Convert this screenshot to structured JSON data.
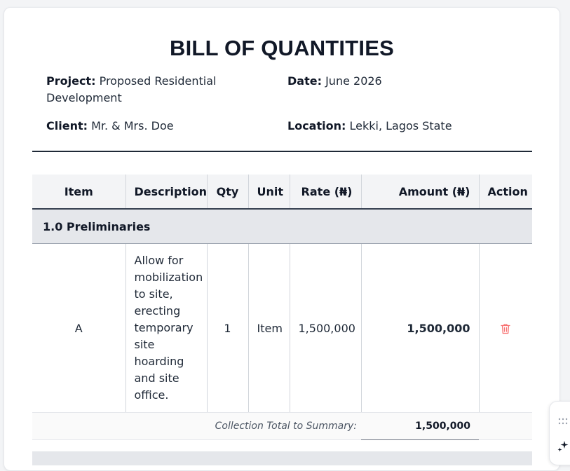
{
  "document": {
    "title": "BILL OF QUANTITIES"
  },
  "meta": {
    "project_label": "Project:",
    "project_value": "Proposed Residential Development",
    "date_label": "Date:",
    "date_value": "June 2026",
    "client_label": "Client:",
    "client_value": "Mr. & Mrs. Doe",
    "location_label": "Location:",
    "location_value": "Lekki, Lagos State"
  },
  "table": {
    "headers": {
      "item": "Item",
      "description": "Description",
      "qty": "Qty",
      "unit": "Unit",
      "rate": "Rate (₦)",
      "amount": "Amount (₦)",
      "action": "Action"
    },
    "sections": [
      {
        "title": "1.0 Preliminaries",
        "rows": [
          {
            "item": "A",
            "description": "Allow for mobilization to site, erecting temporary site hoarding and site office.",
            "qty": "1",
            "unit": "Item",
            "rate": "1,500,000",
            "amount": "1,500,000"
          }
        ],
        "collection_label": "Collection Total to Summary:",
        "collection_total": "1,500,000"
      }
    ]
  },
  "icons": {
    "delete": "trash-icon",
    "drag": "grip-icon",
    "assistant": "sparkle-icon"
  },
  "colors": {
    "delete_icon": "#f87171",
    "header_bg": "#f3f4f6",
    "section_bg": "#e5e7eb"
  }
}
